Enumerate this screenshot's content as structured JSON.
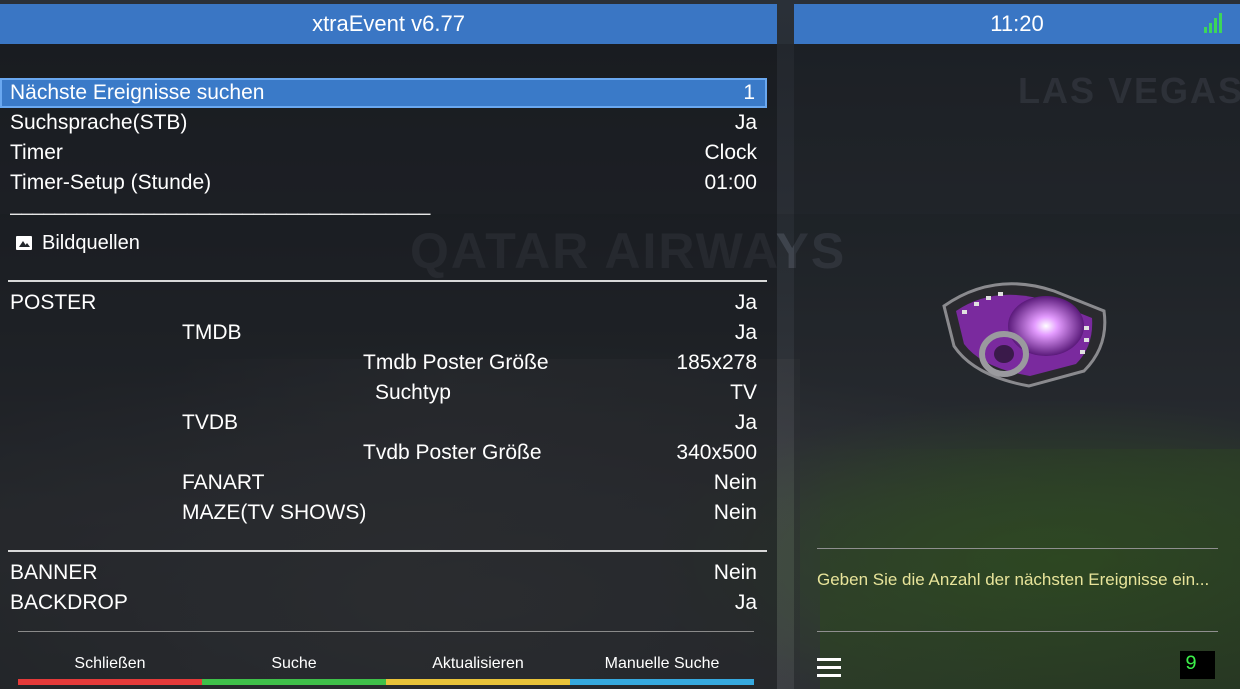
{
  "window": {
    "title": "xtraEvent v6.77"
  },
  "status": {
    "time": "11:20"
  },
  "menu": {
    "rows": [
      {
        "label": "Nächste Ereignisse suchen",
        "value": "1"
      },
      {
        "label": "Suchsprache(STB)",
        "value": "Ja"
      },
      {
        "label": "Timer",
        "value": "Clock"
      },
      {
        "label": "Timer-Setup (Stunde)",
        "value": "01:00"
      }
    ],
    "separator_text": "——————————————————————————————————————",
    "section_label": "Bildquellen",
    "poster": {
      "label": "POSTER",
      "value": "Ja",
      "tmdb": {
        "label": "TMDB",
        "value": "Ja"
      },
      "tmdb_size": {
        "label": "Tmdb Poster Größe",
        "value": "185x278"
      },
      "search_type": {
        "label": "Suchtyp",
        "value": "TV"
      },
      "tvdb": {
        "label": "TVDB",
        "value": "Ja"
      },
      "tvdb_size": {
        "label": "Tvdb Poster Größe",
        "value": "340x500"
      },
      "fanart": {
        "label": "FANART",
        "value": "Nein"
      },
      "maze": {
        "label": "MAZE(TV SHOWS)",
        "value": "Nein"
      }
    },
    "banner": {
      "label": "BANNER",
      "value": "Nein"
    },
    "backdrop": {
      "label": "BACKDROP",
      "value": "Ja"
    }
  },
  "buttons": [
    {
      "label": "Schließen",
      "color": "#e43a3a"
    },
    {
      "label": "Suche",
      "color": "#3fc04a"
    },
    {
      "label": "Aktualisieren",
      "color": "#e8c33a"
    },
    {
      "label": "Manuelle Suche",
      "color": "#36a9df"
    }
  ],
  "help": {
    "text": "Geben Sie die Anzahl der nächsten Ereignisse ein..."
  },
  "input": {
    "number": "9"
  },
  "colors": {
    "accent": "#3a76c4",
    "help_text": "#e8e49a",
    "number": "#3cf04a"
  },
  "icons": {
    "section": "image-icon",
    "signal": "signal-bars-icon",
    "poster": "film-reel-icon",
    "menu": "hamburger-menu-icon"
  }
}
